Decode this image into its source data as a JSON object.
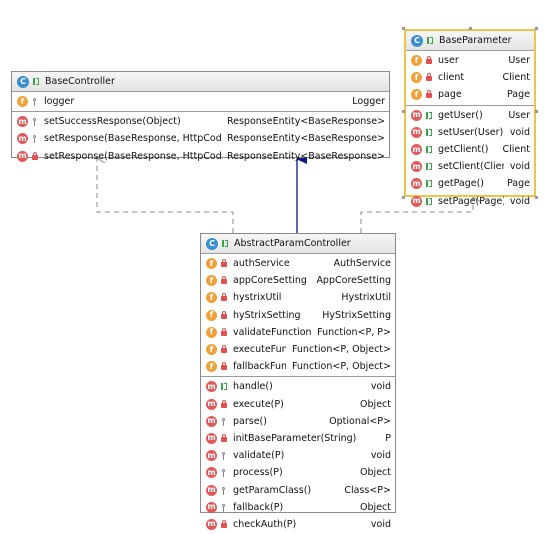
{
  "diagram": {
    "colors": {
      "implements": "#8c8c8c",
      "extends": "#0a1a8c",
      "selection": "#f2c34b"
    },
    "base_controller": {
      "name": "BaseController",
      "fields": [
        {
          "vis": "prot",
          "name": "logger",
          "type": "Logger"
        }
      ],
      "methods": [
        {
          "vis": "prot",
          "name": "setSuccessResponse(Object)",
          "type": "ResponseEntity<BaseResponse>"
        },
        {
          "vis": "prot",
          "name": "setResponse(BaseResponse, HttpCode)",
          "type": "ResponseEntity<BaseResponse>"
        },
        {
          "vis": "priv",
          "name": "setResponse(BaseResponse, HttpCode, Object)",
          "type": "ResponseEntity<BaseResponse>"
        }
      ]
    },
    "base_parameter": {
      "name": "BaseParameter",
      "fields": [
        {
          "vis": "priv",
          "name": "user",
          "type": "User"
        },
        {
          "vis": "priv",
          "name": "client",
          "type": "Client"
        },
        {
          "vis": "priv",
          "name": "page",
          "type": "Page"
        }
      ],
      "methods": [
        {
          "vis": "pub",
          "name": "getUser()",
          "type": "User"
        },
        {
          "vis": "pub",
          "name": "setUser(User)",
          "type": "void"
        },
        {
          "vis": "pub",
          "name": "getClient()",
          "type": "Client"
        },
        {
          "vis": "pub",
          "name": "setClient(Client)",
          "type": "void"
        },
        {
          "vis": "pub",
          "name": "getPage()",
          "type": "Page"
        },
        {
          "vis": "pub",
          "name": "setPage(Page)",
          "type": "void"
        }
      ]
    },
    "abstract_param_controller": {
      "name": "AbstractParamController",
      "fields": [
        {
          "vis": "priv",
          "name": "authService",
          "type": "AuthService"
        },
        {
          "vis": "priv",
          "name": "appCoreSetting",
          "type": "AppCoreSetting"
        },
        {
          "vis": "priv",
          "name": "hystrixUtil",
          "type": "HystrixUtil"
        },
        {
          "vis": "priv",
          "name": "hyStrixSetting",
          "type": "HyStrixSetting"
        },
        {
          "vis": "priv",
          "name": "validateFunction",
          "type": "Function<P, P>"
        },
        {
          "vis": "priv",
          "name": "executeFunction",
          "type": "Function<P, Object>"
        },
        {
          "vis": "priv",
          "name": "fallbackFunction",
          "type": "Function<P, Object>"
        }
      ],
      "methods": [
        {
          "vis": "pub",
          "name": "handle()",
          "type": "void"
        },
        {
          "vis": "priv",
          "name": "execute(P)",
          "type": "Object"
        },
        {
          "vis": "prot",
          "name": "parse()",
          "type": "Optional<P>"
        },
        {
          "vis": "priv",
          "name": "initBaseParameter(String)",
          "type": "P"
        },
        {
          "vis": "prot",
          "name": "validate(P)",
          "type": "void"
        },
        {
          "vis": "prot",
          "name": "process(P)",
          "type": "Object"
        },
        {
          "vis": "prot",
          "name": "getParamClass()",
          "type": "Class<P>"
        },
        {
          "vis": "prot",
          "name": "fallback(P)",
          "type": "Object"
        },
        {
          "vis": "priv",
          "name": "checkAuth(P)",
          "type": "void"
        }
      ]
    }
  }
}
